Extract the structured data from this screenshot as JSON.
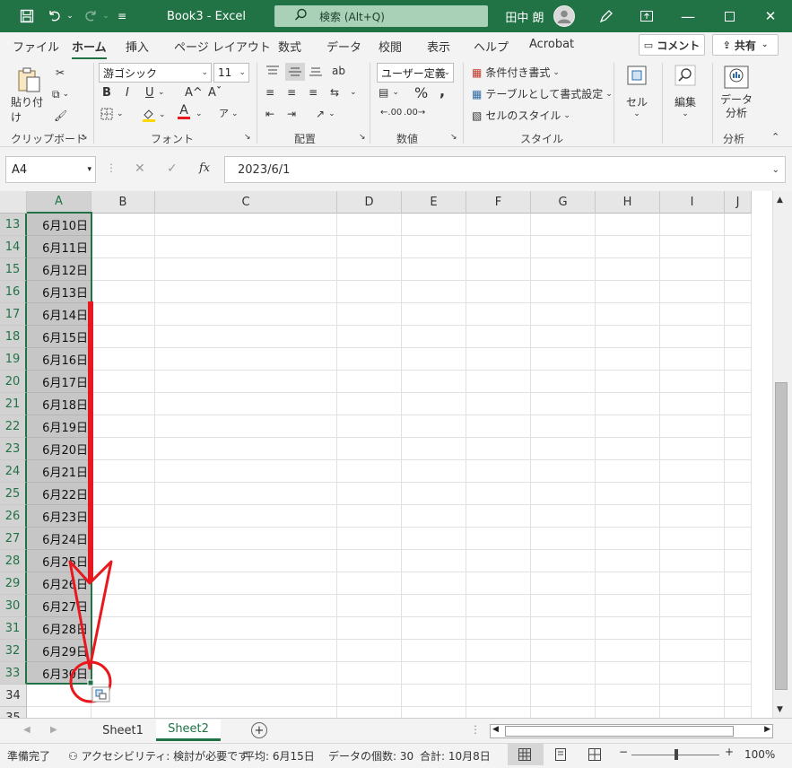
{
  "titlebar": {
    "doc_title": "Book3  -  Excel",
    "search_placeholder": "検索 (Alt+Q)",
    "user_name": "田中 朗"
  },
  "menu": {
    "items": [
      "ファイル",
      "ホーム",
      "挿入",
      "ページ レイアウト",
      "数式",
      "データ",
      "校閲",
      "表示",
      "ヘルプ",
      "Acrobat"
    ],
    "active": "ホーム",
    "comment_btn": "コメント",
    "share_btn": "共有"
  },
  "ribbon": {
    "clipboard": {
      "paste": "貼り付け",
      "label": "クリップボード"
    },
    "font": {
      "family": "游ゴシック",
      "size": "11",
      "label": "フォント",
      "underline_u": "U",
      "bold": "B",
      "italic": "I",
      "increase": "A^",
      "decrease": "Aˇ",
      "font_color_a": "A",
      "phonetic_a": "ア"
    },
    "alignment": {
      "label": "配置"
    },
    "number": {
      "format": "ユーザー定義",
      "percent": "%",
      "comma": ",",
      "inc_decimal": ".00",
      "dec_decimal": ".00",
      "label": "数値"
    },
    "styles": {
      "conditional": "条件付き書式",
      "table": "テーブルとして書式設定",
      "cell_styles": "セルのスタイル",
      "label": "スタイル"
    },
    "cells": {
      "label": "セル"
    },
    "editing": {
      "label": "編集"
    },
    "analysis": {
      "button_line1": "データ",
      "button_line2": "分析",
      "label": "分析"
    }
  },
  "formula_bar": {
    "name_box": "A4",
    "fx": "fx",
    "cancel": "✕",
    "enter": "✓",
    "value": "2023/6/1"
  },
  "grid": {
    "columns": [
      "A",
      "B",
      "C",
      "D",
      "E",
      "F",
      "G",
      "H",
      "I",
      "J"
    ],
    "selected_column": "A",
    "rows": [
      {
        "num": "13",
        "a": "6月10日"
      },
      {
        "num": "14",
        "a": "6月11日"
      },
      {
        "num": "15",
        "a": "6月12日"
      },
      {
        "num": "16",
        "a": "6月13日"
      },
      {
        "num": "17",
        "a": "6月14日"
      },
      {
        "num": "18",
        "a": "6月15日"
      },
      {
        "num": "19",
        "a": "6月16日"
      },
      {
        "num": "20",
        "a": "6月17日"
      },
      {
        "num": "21",
        "a": "6月18日"
      },
      {
        "num": "22",
        "a": "6月19日"
      },
      {
        "num": "23",
        "a": "6月20日"
      },
      {
        "num": "24",
        "a": "6月21日"
      },
      {
        "num": "25",
        "a": "6月22日"
      },
      {
        "num": "26",
        "a": "6月23日"
      },
      {
        "num": "27",
        "a": "6月24日"
      },
      {
        "num": "28",
        "a": "6月25日"
      },
      {
        "num": "29",
        "a": "6月26日"
      },
      {
        "num": "30",
        "a": "6月27日"
      },
      {
        "num": "31",
        "a": "6月28日"
      },
      {
        "num": "32",
        "a": "6月29日"
      },
      {
        "num": "33",
        "a": "6月30日"
      },
      {
        "num": "34",
        "a": ""
      },
      {
        "num": "35",
        "a": ""
      }
    ]
  },
  "sheets": {
    "tabs": [
      "Sheet1",
      "Sheet2"
    ],
    "active": "Sheet2",
    "add": "+"
  },
  "status": {
    "ready": "準備完了",
    "accessibility": "アクセシビリティ: 検討が必要です",
    "average": "平均: 6月15日",
    "count": "データの個数: 30",
    "sum": "合計: 10月8日",
    "zoom": "100%",
    "minus": "−",
    "plus": "+"
  },
  "colors": {
    "excel_green": "#217346",
    "annotation_red": "#e8191e"
  }
}
